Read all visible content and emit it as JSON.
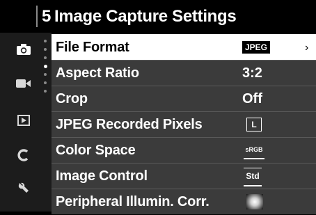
{
  "header": {
    "page_number": "5",
    "title": "Image Capture Settings"
  },
  "rail": {
    "icons": [
      "camera-icon",
      "video-icon",
      "playback-icon",
      "custom-c-icon",
      "wrench-icon"
    ]
  },
  "menu": {
    "rows": [
      {
        "label": "File Format",
        "value": "JPEG",
        "selected": true
      },
      {
        "label": "Aspect Ratio",
        "value": "3:2"
      },
      {
        "label": "Crop",
        "value": "Off"
      },
      {
        "label": "JPEG Recorded Pixels",
        "value": "L"
      },
      {
        "label": "Color Space",
        "value": "sRGB"
      },
      {
        "label": "Image Control",
        "value": "Std"
      },
      {
        "label": "Peripheral Illumin. Corr.",
        "value": ""
      }
    ],
    "chevron": "›"
  }
}
